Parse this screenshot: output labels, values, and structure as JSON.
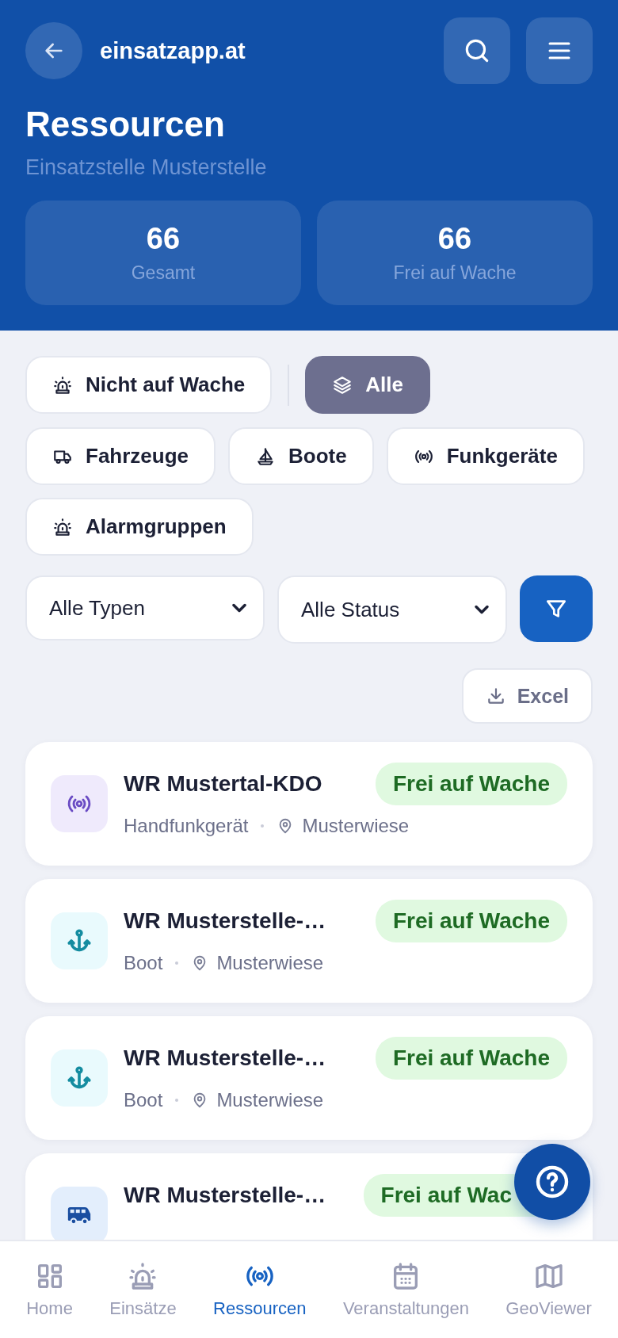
{
  "header": {
    "site": "einsatzapp.at",
    "title": "Ressourcen",
    "subtitle": "Einsatzstelle Musterstelle",
    "stats": [
      {
        "value": "66",
        "label": "Gesamt"
      },
      {
        "value": "66",
        "label": "Frei auf Wache"
      }
    ]
  },
  "scope_chips": [
    {
      "label": "Nicht auf Wache",
      "kind": "siren",
      "selected": false
    },
    {
      "label": "Alle",
      "kind": "layers",
      "selected": true
    }
  ],
  "type_chips": [
    {
      "label": "Fahrzeuge",
      "kind": "truck",
      "selected": false
    },
    {
      "label": "Boote",
      "kind": "boat",
      "selected": false
    },
    {
      "label": "Funkgeräte",
      "kind": "radio",
      "selected": false
    },
    {
      "label": "Alarmgruppen",
      "kind": "siren",
      "selected": false
    }
  ],
  "filters": [
    {
      "value": "Alle Typen"
    },
    {
      "value": "Alle Status"
    }
  ],
  "export": {
    "label": "Excel"
  },
  "resources": [
    {
      "name": "WR Mustertal-KDO",
      "kind": "radio",
      "type": "Handfunkgerät",
      "location": "Musterwiese",
      "status": "Frei auf Wache"
    },
    {
      "name": "WR Musterstelle-…",
      "kind": "boat",
      "type": "Boot",
      "location": "Musterwiese",
      "status": "Frei auf Wache"
    },
    {
      "name": "WR Musterstelle-…",
      "kind": "boat",
      "type": "Boot",
      "location": "Musterwiese",
      "status": "Frei auf Wache"
    },
    {
      "name": "WR Musterstelle-…",
      "kind": "vehicle",
      "status": "Frei auf Wac"
    }
  ],
  "nav": [
    {
      "label": "Home",
      "kind": "grid",
      "selected": false
    },
    {
      "label": "Einsätze",
      "kind": "siren",
      "selected": false
    },
    {
      "label": "Ressourcen",
      "kind": "radio",
      "selected": true
    },
    {
      "label": "Veranstaltungen",
      "kind": "calendar",
      "selected": false
    },
    {
      "label": "GeoViewer",
      "kind": "map",
      "selected": false
    }
  ]
}
